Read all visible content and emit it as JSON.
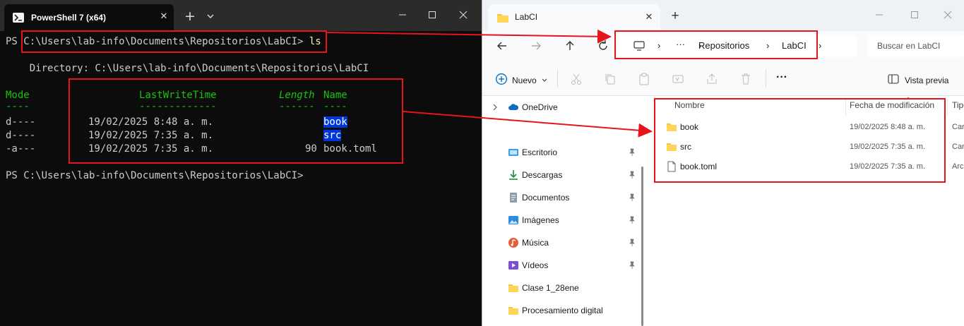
{
  "terminal": {
    "tab_title": "PowerShell 7 (x64)",
    "tab_close": "✕",
    "new_tab": "+",
    "lines": {
      "prompt1_ps": "PS ",
      "prompt1_path": "C:\\Users\\lab-info\\Documents\\Repositorios\\LabCI>",
      "prompt1_cmd": " ls",
      "directory": "    Directory: C:\\Users\\lab-info\\Documents\\Repositorios\\LabCI",
      "header_mode": "Mode",
      "header_lwt": "LastWriteTime",
      "header_length": "Length",
      "header_name": "Name",
      "under_mode": "----",
      "under_lwt": "-------------",
      "under_length": "------",
      "under_name": "----",
      "prompt2": "PS C:\\Users\\lab-info\\Documents\\Repositorios\\LabCI>"
    },
    "rows": [
      {
        "mode": "d----",
        "time": "19/02/2025 8:48 a. m.",
        "length": "",
        "name": "book",
        "highlight": true
      },
      {
        "mode": "d----",
        "time": "19/02/2025 7:35 a. m.",
        "length": "",
        "name": "src",
        "highlight": true
      },
      {
        "mode": "-a---",
        "time": "19/02/2025 7:35 a. m.",
        "length": "90",
        "name": "book.toml",
        "highlight": false
      }
    ],
    "colors": {
      "background": "#0c0c0c",
      "text": "#cccccc",
      "command": "#f9f1a5",
      "header": "#16c60c",
      "selection": "#0037da"
    }
  },
  "explorer": {
    "tab_title": "LabCI",
    "tab_close": "✕",
    "new_tab": "+",
    "breadcrumb": {
      "more": "···",
      "items": [
        "Repositorios",
        "LabCI"
      ],
      "sep": "›"
    },
    "search_placeholder": "Buscar en LabCI",
    "toolbar": {
      "new_label": "Nuevo",
      "more": "···",
      "preview_label": "Vista previa"
    },
    "sidebar": {
      "onedrive": "OneDrive",
      "items": [
        {
          "label": "Escritorio",
          "icon": "desktop-icon",
          "pinned": true
        },
        {
          "label": "Descargas",
          "icon": "download-icon",
          "pinned": true
        },
        {
          "label": "Documentos",
          "icon": "document-icon",
          "pinned": true
        },
        {
          "label": "Imágenes",
          "icon": "image-icon",
          "pinned": true
        },
        {
          "label": "Música",
          "icon": "music-icon",
          "pinned": true
        },
        {
          "label": "Vídeos",
          "icon": "video-icon",
          "pinned": true
        },
        {
          "label": "Clase 1_28ene",
          "icon": "folder-icon",
          "pinned": false
        },
        {
          "label": "Procesamiento digital",
          "icon": "folder-icon",
          "pinned": false
        }
      ]
    },
    "columns": {
      "name": "Nombre",
      "date": "Fecha de modificación",
      "type": "Tipo"
    },
    "files": [
      {
        "name": "book",
        "date": "19/02/2025 8:48 a. m.",
        "type": "Car",
        "icon": "folder-icon"
      },
      {
        "name": "src",
        "date": "19/02/2025 7:35 a. m.",
        "type": "Car",
        "icon": "folder-icon"
      },
      {
        "name": "book.toml",
        "date": "19/02/2025 7:35 a. m.",
        "type": "Arc",
        "icon": "file-icon"
      }
    ],
    "colors": {
      "folder": "#f4c542",
      "accent": "#0067c0"
    }
  },
  "annotation_color": "#e8141b"
}
